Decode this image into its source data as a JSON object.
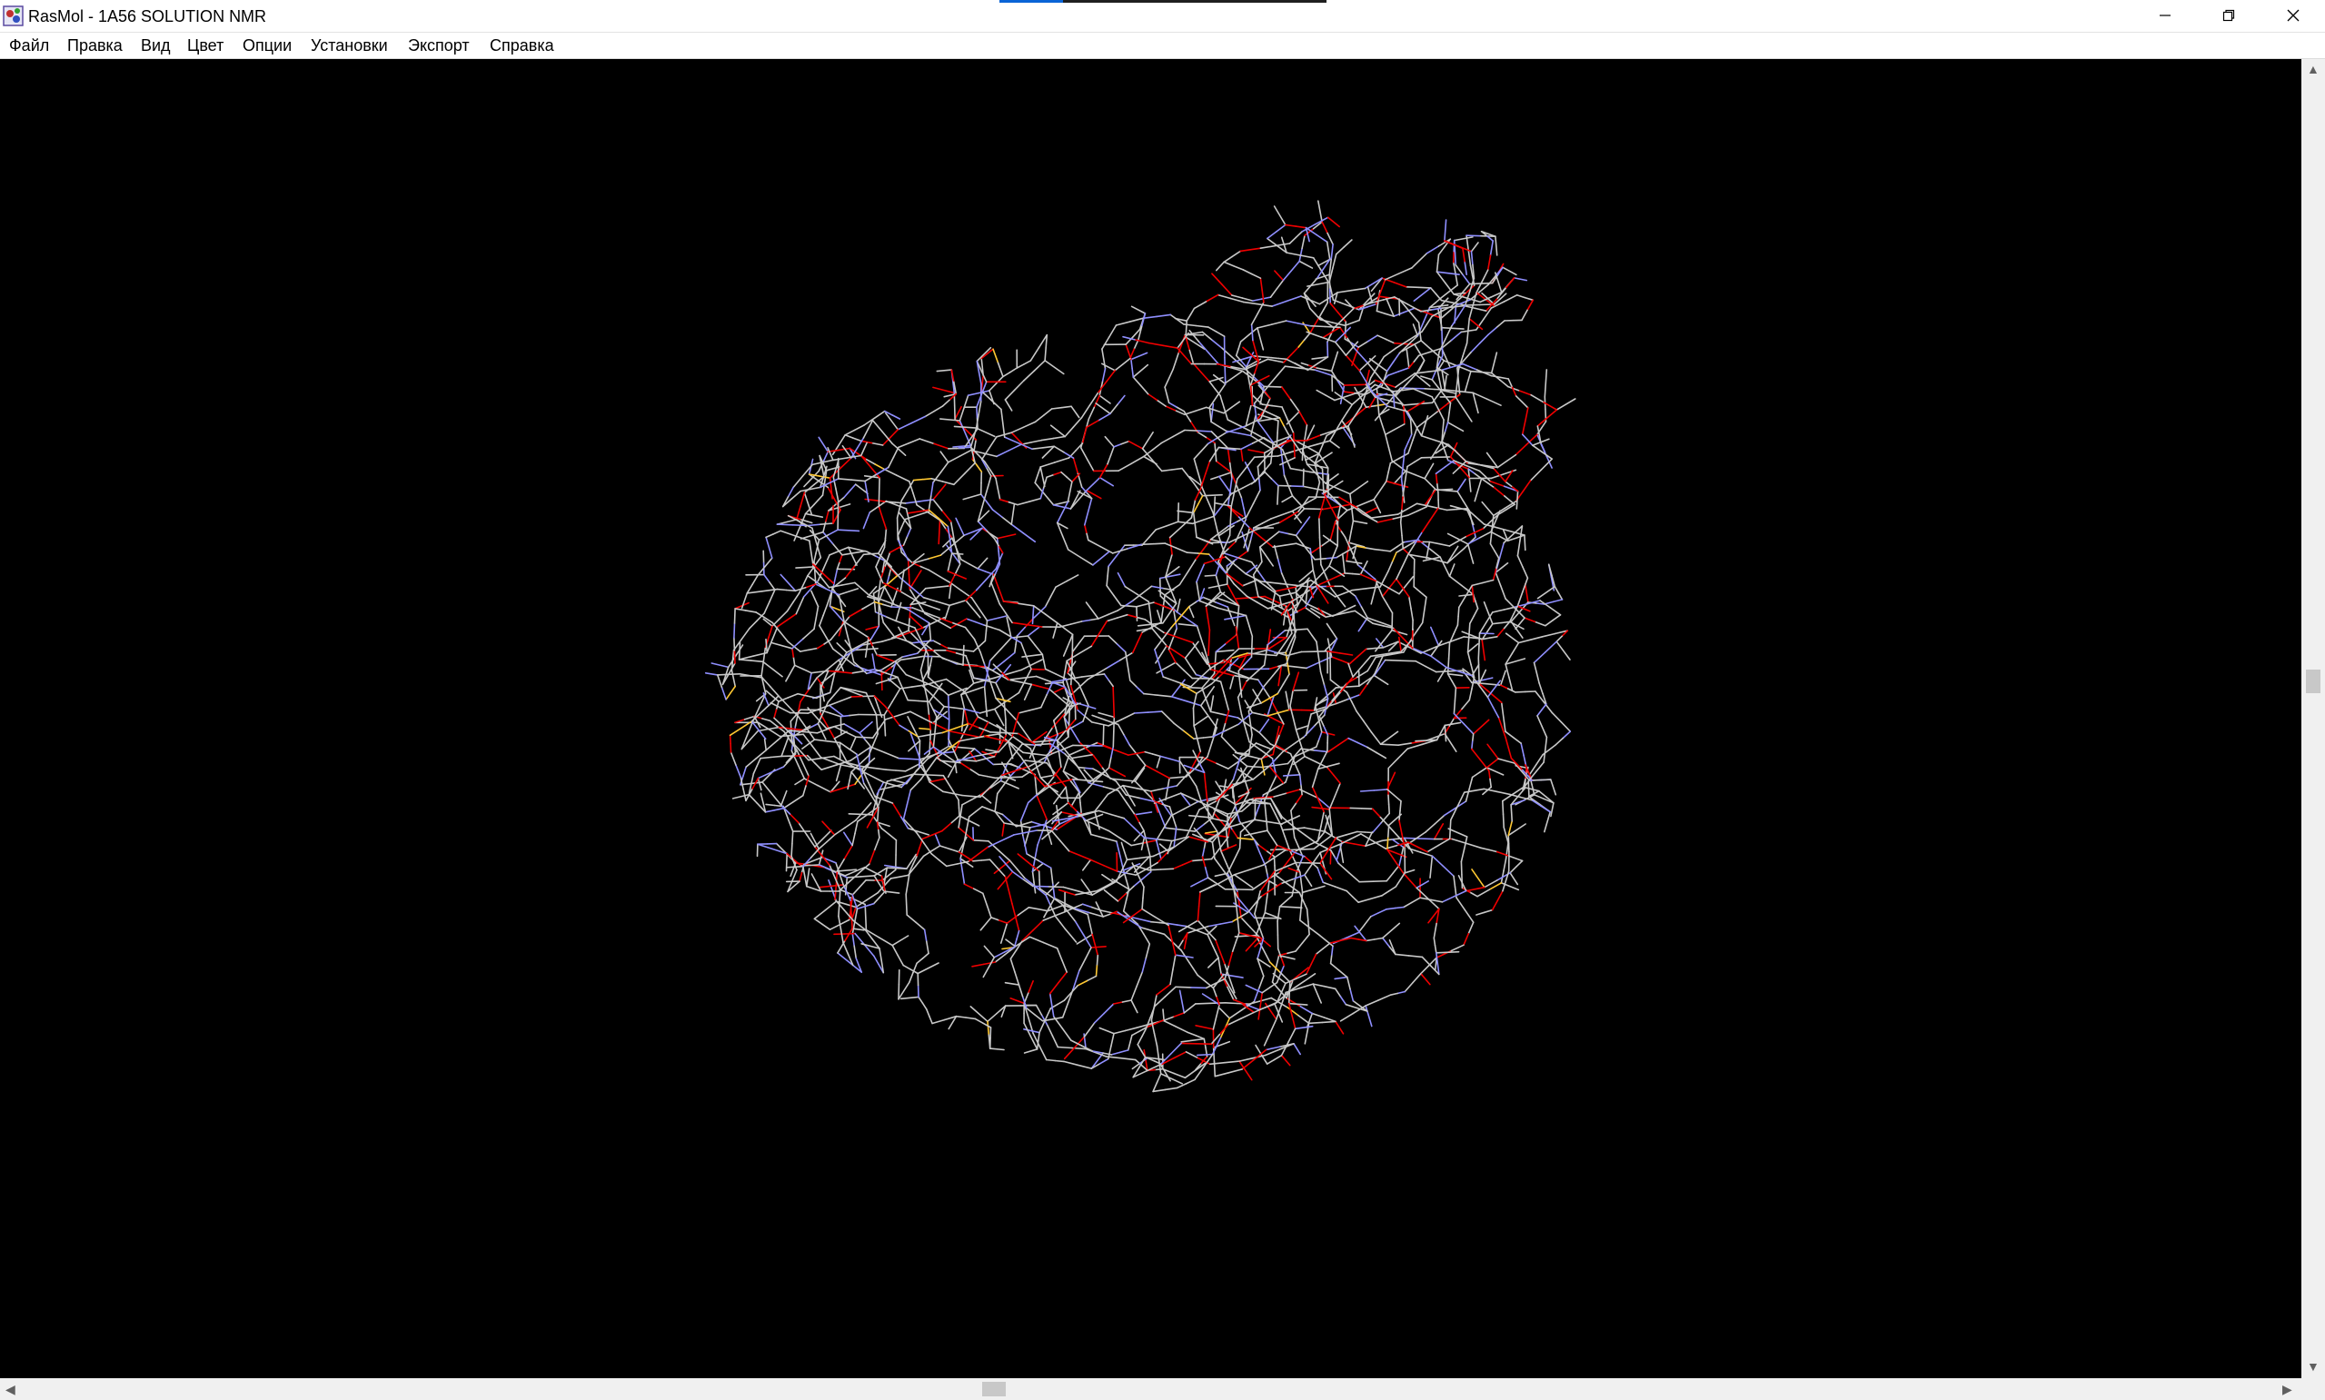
{
  "window": {
    "title": "RasMol - 1A56 SOLUTION NMR",
    "controls": {
      "minimize": "minimize-icon",
      "restore": "restore-icon",
      "close": "close-icon"
    }
  },
  "menu": {
    "items": [
      "Файл",
      "Правка",
      "Вид",
      "Цвет",
      "Опции",
      "Установки",
      "Экспорт",
      "Справка"
    ]
  },
  "viewer": {
    "background_color": "#000000",
    "molecule": "1A56",
    "render_style": "wireframe",
    "atom_colors": {
      "carbon": "#c8c8c8",
      "nitrogen": "#8f8fff",
      "oxygen": "#f00000",
      "sulfur": "#ffc832"
    }
  },
  "scrollbars": {
    "vertical_position": 0.47,
    "horizontal_position": 0.43
  }
}
